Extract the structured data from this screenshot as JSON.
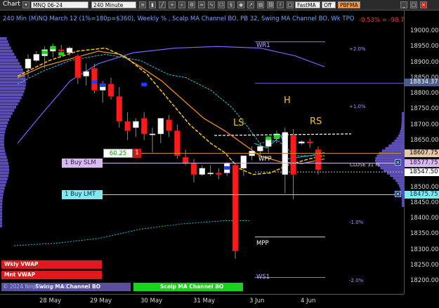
{
  "toolbar": {
    "chart_label": "Chart",
    "instrument": "MNQ 06-24",
    "interval": "240 Minute",
    "template_select": "FastMA",
    "toggle": "Off",
    "indicator_btn": "PBFMA"
  },
  "title": "240 Min (M)NQ March 12 (1%=180p=$360), Weekly % , Scalp MA Channel BO, PB 32, Swing MA Channel BO, Wk TPO",
  "pnl": "-0.53% = -98.75",
  "copyright": "© 2024 NinjaTrader, LLC",
  "levels": {
    "wr1": "WR1",
    "ws1": "WS1",
    "wpp": "WPP",
    "mpp": "MPP",
    "close": "CLOSE 31 M",
    "p2": "+2.0%",
    "p1": "+1.0%",
    "m1": "-1.0%",
    "m2": "-2.0%"
  },
  "pattern": {
    "ls": "LS",
    "h": "H",
    "rs": "RS"
  },
  "orders": {
    "buy_slm": "1 Buy SLM",
    "buy_lmt": "1 Buy LMT",
    "stop_price": "60.25",
    "qty": "1"
  },
  "bottom_bars": {
    "wkly_vwap": "Wkly VWAP",
    "mnt_vwap": "Mnt VWAP",
    "swing": "Swing MA Channel BO",
    "scalp": "Scalp MA Channel BO"
  },
  "y_axis": {
    "ticks": [
      "19000.00",
      "18950.00",
      "18900.00",
      "18850.00",
      "18800.00",
      "18750.00",
      "18700.00",
      "18650.00",
      "18600.00",
      "18550.00",
      "18500.00",
      "18450.00",
      "18400.00",
      "18350.00",
      "18300.00",
      "18250.00",
      "18200.00"
    ],
    "badges": {
      "top": "18834.37",
      "price": "18607.75",
      "slm": "18577.75",
      "mid": "18547.50",
      "lmt": "18475.75"
    }
  },
  "x_axis": {
    "ticks": [
      "28 May",
      "29 May",
      "30 May",
      "31 May",
      "3 Jun",
      "4 Jun"
    ]
  },
  "colors": {
    "up": "#ffffff",
    "down": "#ff1a1a",
    "title": "#79a3ff",
    "profile": "#6b5cd6",
    "orange_ma": "#f08a24",
    "yellow_ma": "#f5c518",
    "cyan": "#26c6da",
    "purple_ma": "#7b61ff"
  },
  "chart_data": {
    "type": "candlestick",
    "candles": [
      {
        "o": 18880,
        "h": 18925,
        "l": 18850,
        "c": 18910
      },
      {
        "o": 18905,
        "h": 18935,
        "l": 18900,
        "c": 18925
      },
      {
        "o": 18920,
        "h": 18950,
        "l": 18880,
        "c": 18940
      },
      {
        "o": 18935,
        "h": 18960,
        "l": 18915,
        "c": 18945
      },
      {
        "o": 18940,
        "h": 18955,
        "l": 18920,
        "c": 18935
      },
      {
        "o": 18930,
        "h": 18950,
        "l": 18920,
        "c": 18945
      },
      {
        "o": 18920,
        "h": 18925,
        "l": 18830,
        "c": 18850
      },
      {
        "o": 18855,
        "h": 18895,
        "l": 18825,
        "c": 18870
      },
      {
        "o": 18880,
        "h": 18895,
        "l": 18800,
        "c": 18810
      },
      {
        "o": 18810,
        "h": 18840,
        "l": 18770,
        "c": 18830
      },
      {
        "o": 18830,
        "h": 18850,
        "l": 18780,
        "c": 18790
      },
      {
        "o": 18790,
        "h": 18820,
        "l": 18690,
        "c": 18710
      },
      {
        "o": 18710,
        "h": 18740,
        "l": 18650,
        "c": 18680
      },
      {
        "o": 18690,
        "h": 18720,
        "l": 18660,
        "c": 18710
      },
      {
        "o": 18720,
        "h": 18740,
        "l": 18650,
        "c": 18670
      },
      {
        "o": 18670,
        "h": 18690,
        "l": 18610,
        "c": 18670
      },
      {
        "o": 18670,
        "h": 18720,
        "l": 18640,
        "c": 18720
      },
      {
        "o": 18715,
        "h": 18730,
        "l": 18660,
        "c": 18680
      },
      {
        "o": 18680,
        "h": 18700,
        "l": 18590,
        "c": 18600
      },
      {
        "o": 18595,
        "h": 18620,
        "l": 18570,
        "c": 18575
      },
      {
        "o": 18575,
        "h": 18590,
        "l": 18515,
        "c": 18540
      },
      {
        "o": 18540,
        "h": 18570,
        "l": 18535,
        "c": 18560
      },
      {
        "o": 18545,
        "h": 18570,
        "l": 18535,
        "c": 18545
      },
      {
        "o": 18545,
        "h": 18560,
        "l": 18525,
        "c": 18540
      },
      {
        "o": 18545,
        "h": 18580,
        "l": 18535,
        "c": 18575
      },
      {
        "o": 18570,
        "h": 18575,
        "l": 18270,
        "c": 18295
      },
      {
        "o": 18560,
        "h": 18600,
        "l": 18535,
        "c": 18600
      },
      {
        "o": 18600,
        "h": 18630,
        "l": 18585,
        "c": 18615
      },
      {
        "o": 18615,
        "h": 18640,
        "l": 18600,
        "c": 18630
      },
      {
        "o": 18630,
        "h": 18660,
        "l": 18610,
        "c": 18655
      },
      {
        "o": 18655,
        "h": 18680,
        "l": 18640,
        "c": 18670
      },
      {
        "o": 18540,
        "h": 18690,
        "l": 18480,
        "c": 18675
      },
      {
        "o": 18665,
        "h": 18685,
        "l": 18460,
        "c": 18540
      },
      {
        "o": 18640,
        "h": 18650,
        "l": 18635,
        "c": 18645
      },
      {
        "o": 18645,
        "h": 18655,
        "l": 18625,
        "c": 18640
      },
      {
        "o": 18620,
        "h": 18630,
        "l": 18540,
        "c": 18555
      }
    ]
  }
}
